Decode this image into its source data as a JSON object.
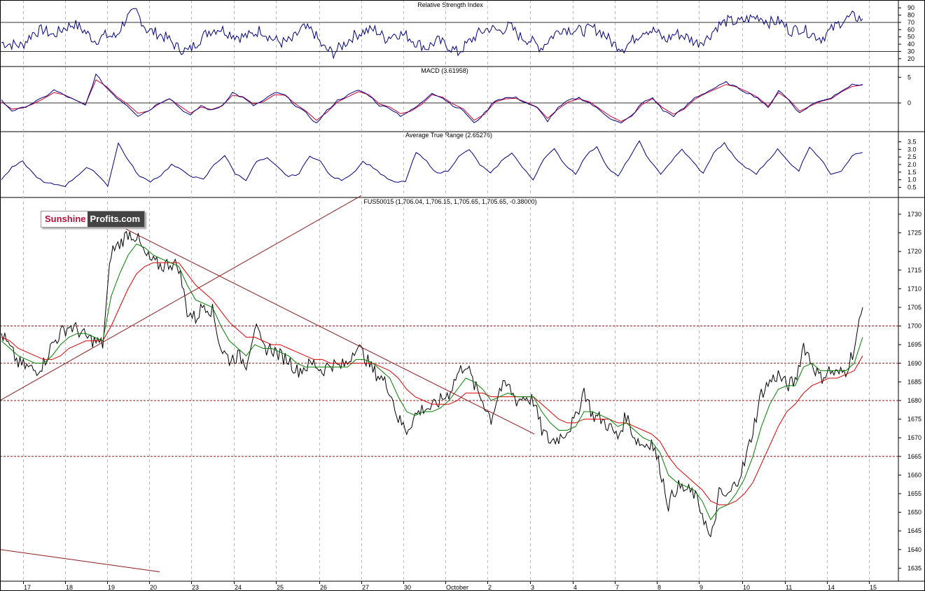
{
  "colors": {
    "price": "#000000",
    "rsi": "#000080",
    "macd": "#000080",
    "macd_signal": "#cc0033",
    "atr": "#000080",
    "ma_fast": "#008000",
    "ma_slow": "#dd0000",
    "trendline": "#8b1a1a",
    "support_line": "#8b1a1a",
    "grid": "#bbbbbb"
  },
  "logo": {
    "part1": "Sunshine",
    "part2": "Profits.com"
  },
  "chart_data": [
    {
      "type": "line",
      "title": "Relative Strength Index",
      "y_ticks": [
        "90",
        "80",
        "70",
        "60",
        "50",
        "40",
        "30",
        "20"
      ],
      "ylim": [
        15,
        95
      ],
      "levels": [
        30,
        70
      ],
      "series": [
        {
          "values": [
            42,
            40,
            38,
            55,
            60,
            52,
            62,
            68,
            58,
            45,
            52,
            50,
            75,
            85,
            60,
            55,
            48,
            35,
            30,
            45,
            58,
            62,
            55,
            50,
            52,
            60,
            48,
            42,
            45,
            62,
            58,
            35,
            28,
            40,
            52,
            58,
            60,
            48,
            55,
            52,
            42,
            35,
            45,
            38,
            28,
            42,
            55,
            62,
            58,
            65,
            50,
            45,
            35,
            50,
            62,
            60,
            58,
            62,
            55,
            40,
            35,
            48,
            60,
            58,
            45,
            55,
            50,
            42,
            48,
            65,
            72,
            70,
            75,
            78,
            70,
            72,
            58,
            62,
            55,
            48,
            60,
            72,
            78,
            75
          ]
        }
      ]
    },
    {
      "type": "line",
      "title": "MACD (3.61958)",
      "y_ticks": [
        "5",
        "0"
      ],
      "ylim": [
        -4.5,
        6
      ],
      "series": [
        {
          "values": [
            0.5,
            -1.5,
            -1.0,
            0,
            1,
            2.5,
            1.5,
            0.5,
            -0.5,
            5.5,
            3,
            1,
            -0.5,
            -2.5,
            -1.5,
            0,
            1,
            -1,
            -2.5,
            -0.5,
            -1.5,
            -0.5,
            2,
            1,
            -0.5,
            0.5,
            2,
            1.5,
            -0.5,
            -2,
            -4,
            -1.5,
            0.5,
            1.5,
            2.5,
            1.5,
            -0.5,
            -1,
            -2.5,
            -1.5,
            0,
            2,
            1,
            -0.5,
            -1.5,
            -4,
            -2,
            0.5,
            1,
            1,
            0,
            -1,
            -3.5,
            -1,
            0.5,
            1,
            0,
            -1.5,
            -3,
            -4,
            -2.5,
            0,
            1,
            -1.5,
            -2.5,
            -1,
            1,
            2,
            3,
            4,
            3,
            2,
            1,
            -1,
            2.5,
            0.5,
            -2,
            -0.5,
            0.5,
            1,
            2.5,
            3.5,
            3.6
          ]
        },
        {
          "values": [
            0.2,
            -1.2,
            -1.0,
            -0.2,
            0.8,
            2.0,
            1.6,
            0.6,
            -0.3,
            4.5,
            3.2,
            1.2,
            -0.2,
            -2.0,
            -1.6,
            -0.2,
            0.8,
            -0.6,
            -2.0,
            -0.8,
            -1.3,
            -0.6,
            1.5,
            1.2,
            -0.2,
            0.3,
            1.6,
            1.5,
            -0.2,
            -1.6,
            -3.4,
            -1.8,
            0.2,
            1.2,
            2.2,
            1.6,
            -0.2,
            -0.8,
            -2.1,
            -1.6,
            -0.3,
            1.6,
            1.1,
            -0.2,
            -1.2,
            -3.4,
            -2.2,
            0.2,
            0.8,
            0.9,
            0.1,
            -0.8,
            -3.0,
            -1.2,
            0.2,
            0.8,
            0.2,
            -1.2,
            -2.6,
            -3.6,
            -2.6,
            -0.3,
            0.8,
            -1.0,
            -2.2,
            -1.2,
            0.7,
            1.8,
            2.7,
            3.6,
            3.1,
            2.2,
            1.1,
            -0.6,
            2.0,
            0.6,
            -1.6,
            -0.6,
            0.3,
            0.8,
            2.2,
            3.2,
            3.5
          ]
        }
      ]
    },
    {
      "type": "line",
      "title": "Average True Range (2.65276)",
      "y_ticks": [
        "3.5",
        "3.0",
        "2.5",
        "2.0",
        "1.5",
        "1.0",
        "0.5"
      ],
      "ylim": [
        0.2,
        3.8
      ],
      "series": [
        {
          "values": [
            1.0,
            1.8,
            2.2,
            1.4,
            0.8,
            0.7,
            0.6,
            1.2,
            1.8,
            1.4,
            0.6,
            3.4,
            2.2,
            1.2,
            0.9,
            1.3,
            2.0,
            1.6,
            1.2,
            1.0,
            2.0,
            2.6,
            1.4,
            1.0,
            2.2,
            2.4,
            1.8,
            1.2,
            1.4,
            2.6,
            2.2,
            1.2,
            1.0,
            1.4,
            2.2,
            1.8,
            1.2,
            0.8,
            0.9,
            2.8,
            2.2,
            1.4,
            1.6,
            2.5,
            3.0,
            2.0,
            1.4,
            2.2,
            2.8,
            1.8,
            1.0,
            2.4,
            3.0,
            2.0,
            1.4,
            2.6,
            3.2,
            1.8,
            1.2,
            2.4,
            3.5,
            2.2,
            1.4,
            2.2,
            3.0,
            2.2,
            1.4,
            2.8,
            3.4,
            2.4,
            1.8,
            1.4,
            2.2,
            3.0,
            2.2,
            1.6,
            3.2,
            2.4,
            1.4,
            1.6,
            2.6,
            2.8
          ]
        }
      ]
    },
    {
      "type": "line",
      "title": "FUS50015 (1,706.04, 1,706.15, 1,705.65, 1,705.65, -0.38000)",
      "x_ticks": [
        "17",
        "18",
        "19",
        "20",
        "23",
        "24",
        "25",
        "26",
        "27",
        "30",
        "October",
        "2",
        "3",
        "4",
        "7",
        "8",
        "9",
        "10",
        "11",
        "14",
        "15"
      ],
      "y_ticks": [
        "1730",
        "1725",
        "1720",
        "1715",
        "1710",
        "1705",
        "1700",
        "1695",
        "1690",
        "1685",
        "1680",
        "1675",
        "1670",
        "1665",
        "1660",
        "1655",
        "1650",
        "1645",
        "1640",
        "1635"
      ],
      "ylim": [
        1633,
        1733
      ],
      "horizontal_levels": [
        1700,
        1690,
        1680,
        1665
      ],
      "series": [
        {
          "values": [
            1698,
            1694,
            1690,
            1689,
            1688,
            1690,
            1695,
            1698,
            1700,
            1699,
            1697,
            1696,
            1695,
            1720,
            1722,
            1725,
            1724,
            1719,
            1717,
            1716,
            1717,
            1716,
            1704,
            1702,
            1706,
            1704,
            1694,
            1691,
            1692,
            1690,
            1700,
            1694,
            1694,
            1692,
            1691,
            1688,
            1689,
            1690,
            1688,
            1690,
            1689,
            1690,
            1695,
            1692,
            1688,
            1686,
            1683,
            1675,
            1672,
            1676,
            1678,
            1678,
            1680,
            1682,
            1687,
            1690,
            1684,
            1680,
            1675,
            1683,
            1684,
            1680,
            1681,
            1680,
            1672,
            1669,
            1670,
            1672,
            1675,
            1683,
            1676,
            1675,
            1673,
            1670,
            1676,
            1670,
            1668,
            1669,
            1662,
            1652,
            1657,
            1656,
            1655,
            1650,
            1642,
            1655,
            1654,
            1658,
            1663,
            1672,
            1682,
            1685,
            1687,
            1684,
            1685,
            1695,
            1690,
            1686,
            1688,
            1687,
            1688,
            1694,
            1705
          ]
        },
        {
          "values": [
            1696,
            1694,
            1692,
            1691,
            1690,
            1690,
            1692,
            1695,
            1697,
            1698,
            1698,
            1697,
            1696,
            1708,
            1714,
            1719,
            1722,
            1721,
            1719,
            1718,
            1717,
            1716,
            1711,
            1707,
            1706,
            1705,
            1700,
            1696,
            1694,
            1692,
            1695,
            1694,
            1694,
            1693,
            1692,
            1690,
            1689,
            1689,
            1689,
            1689,
            1689,
            1689,
            1691,
            1691,
            1690,
            1688,
            1686,
            1681,
            1677,
            1676,
            1677,
            1677,
            1678,
            1680,
            1683,
            1686,
            1685,
            1683,
            1680,
            1681,
            1682,
            1681,
            1681,
            1681,
            1677,
            1674,
            1672,
            1672,
            1673,
            1677,
            1677,
            1676,
            1675,
            1673,
            1674,
            1672,
            1670,
            1669,
            1666,
            1660,
            1658,
            1657,
            1656,
            1653,
            1648,
            1651,
            1652,
            1655,
            1659,
            1665,
            1673,
            1679,
            1683,
            1684,
            1684,
            1689,
            1690,
            1688,
            1688,
            1688,
            1688,
            1690,
            1697
          ]
        },
        {
          "values": [
            1697,
            1696,
            1694,
            1693,
            1692,
            1691,
            1691,
            1692,
            1694,
            1695,
            1696,
            1696,
            1696,
            1700,
            1705,
            1710,
            1714,
            1716,
            1717,
            1717,
            1717,
            1717,
            1714,
            1711,
            1709,
            1707,
            1704,
            1701,
            1699,
            1697,
            1697,
            1696,
            1695,
            1695,
            1694,
            1693,
            1692,
            1691,
            1691,
            1690,
            1690,
            1690,
            1690,
            1690,
            1690,
            1689,
            1688,
            1686,
            1683,
            1681,
            1680,
            1679,
            1679,
            1679,
            1680,
            1682,
            1682,
            1682,
            1681,
            1681,
            1681,
            1681,
            1681,
            1681,
            1679,
            1677,
            1675,
            1674,
            1674,
            1675,
            1675,
            1675,
            1675,
            1674,
            1674,
            1673,
            1672,
            1671,
            1669,
            1665,
            1662,
            1660,
            1658,
            1656,
            1653,
            1652,
            1652,
            1653,
            1655,
            1658,
            1663,
            1668,
            1673,
            1677,
            1679,
            1682,
            1684,
            1685,
            1686,
            1686,
            1687,
            1688,
            1692
          ]
        }
      ],
      "trendlines": [
        {
          "from": [
            "17",
            1680
          ],
          "to": [
            "27",
            1735
          ]
        },
        {
          "from": [
            "19",
            1726
          ],
          "to": [
            "3",
            1671
          ]
        },
        {
          "from": [
            "17",
            1640
          ],
          "to": [
            "20",
            1634
          ]
        }
      ]
    }
  ]
}
